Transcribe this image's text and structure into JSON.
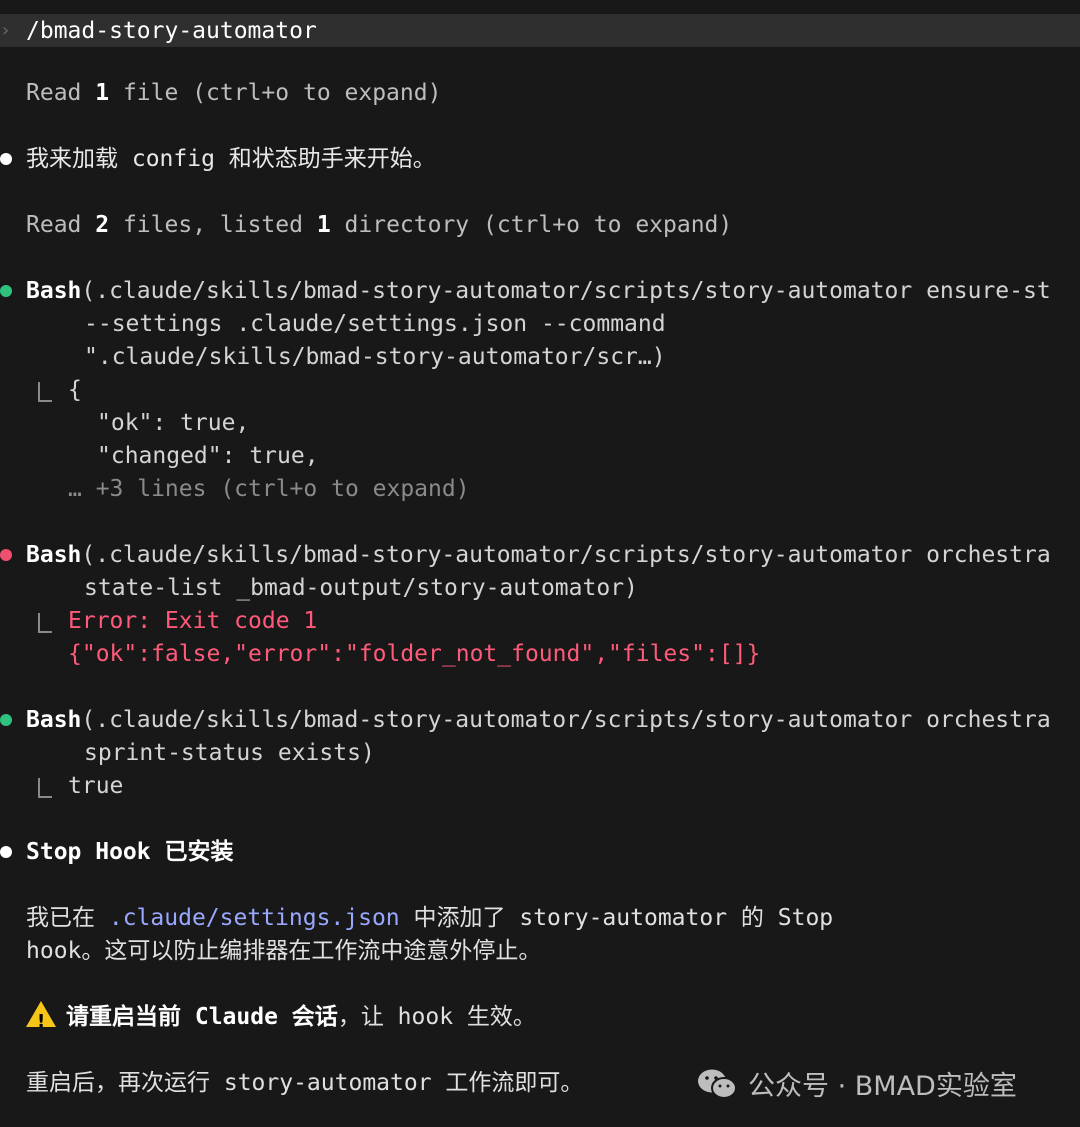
{
  "command": "/bmad-story-automator",
  "read1": {
    "prefix": "Read ",
    "count": "1",
    "suffix": " file (ctrl+o to expand)"
  },
  "msg1": "我来加载 config 和状态助手来开始。",
  "read2": {
    "prefix": "Read ",
    "n1": "2",
    "mid": " files, listed ",
    "n2": "1",
    "suffix": " directory (ctrl+o to expand)"
  },
  "bash1": {
    "tool": "Bash",
    "line1": "(.claude/skills/bmad-story-automator/scripts/story-automator ensure-st",
    "line2": "--settings .claude/settings.json --command",
    "line3": "\".claude/skills/bmad-story-automator/scr…)",
    "out1": "{",
    "out2": "\"ok\": true,",
    "out3": "\"changed\": true,",
    "more": "… +3 lines (ctrl+o to expand)"
  },
  "bash2": {
    "tool": "Bash",
    "line1": "(.claude/skills/bmad-story-automator/scripts/story-automator orchestra",
    "line2": "state-list _bmad-output/story-automator)",
    "err1": "Error: Exit code 1",
    "err2": "{\"ok\":false,\"error\":\"folder_not_found\",\"files\":[]}"
  },
  "bash3": {
    "tool": "Bash",
    "line1": "(.claude/skills/bmad-story-automator/scripts/story-automator orchestra",
    "line2": "sprint-status exists)",
    "out1": "true"
  },
  "hook": {
    "title_en": "Stop Hook",
    "title_cn": " 已安装",
    "p1a": "我已在 ",
    "p1path": ".claude/settings.json",
    "p1b": " 中添加了 story-automator 的 Stop",
    "p2": "hook。这可以防止编排器在工作流中途意外停止。",
    "warn_a": "请重启当前 ",
    "warn_b": "Claude",
    "warn_c": " 会话",
    "warn_d": "，让 hook 生效。",
    "last": "重启后，再次运行 story-automator 工作流即可。"
  },
  "watermark": "公众号 · BMAD实验室",
  "colors": {
    "bg": "#181818",
    "green": "#2ec27e",
    "red": "#f0506e",
    "error": "#ff5a7a",
    "path": "#9aa7ff",
    "warn": "#f5c518"
  }
}
